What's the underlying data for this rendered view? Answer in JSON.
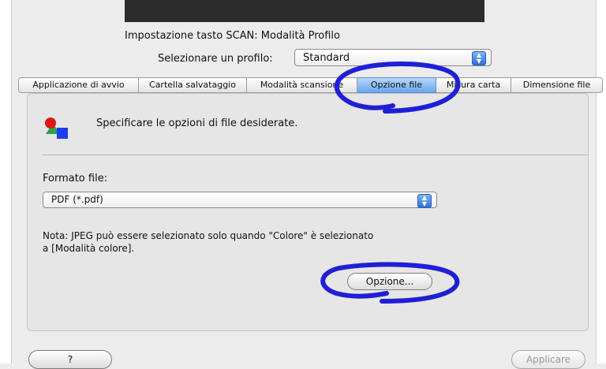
{
  "header": {
    "title": "Impostazione tasto SCAN: Modalità Profilo",
    "profile_label": "Selezionare un profilo:",
    "profile_value": "Standard"
  },
  "tabs": [
    {
      "label": "Applicazione di avvio",
      "active": false
    },
    {
      "label": "Cartella salvataggio",
      "active": false
    },
    {
      "label": "Modalità scansione",
      "active": false
    },
    {
      "label": "Opzione file",
      "active": true
    },
    {
      "label": "Misura carta",
      "active": false
    },
    {
      "label": "Dimensione file",
      "active": false
    }
  ],
  "panel": {
    "description": "Specificare le opzioni di file desiderate.",
    "format_label": "Formato file:",
    "format_value": "PDF (*.pdf)",
    "note_line1": "Nota: JPEG può essere selezionato solo quando \"Colore\" è selezionato",
    "note_line2": "a [Modalità colore].",
    "option_button": "Opzione..."
  },
  "footer": {
    "help_button": "?",
    "apply_button": "Applicare"
  },
  "icons": {
    "panel_icon": "shapes-icon",
    "stepper": "up-down-arrows-icon"
  },
  "colors": {
    "annotation": "#1f1fd6",
    "active_tab": "#8bbcf3"
  }
}
